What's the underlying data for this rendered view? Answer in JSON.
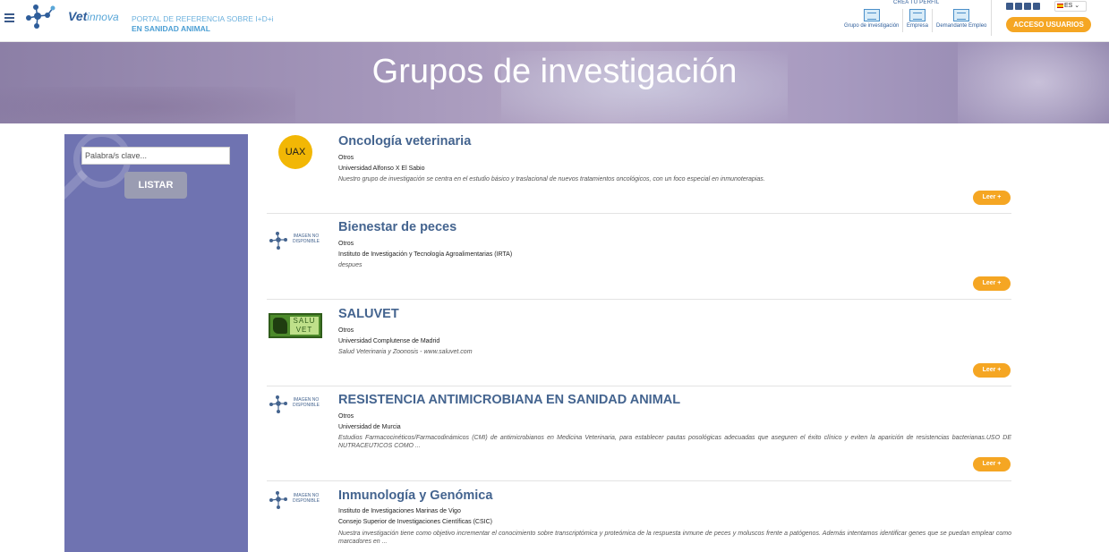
{
  "header": {
    "logo_main": "Vet",
    "logo_sub": "innova",
    "tagline_line1": "PORTAL DE REFERENCIA SOBRE I+D+i",
    "tagline_line2": "EN SANIDAD ANIMAL",
    "crea_label": "CREA TU PERFIL",
    "profile_options": [
      {
        "label": "Grupo de investigación"
      },
      {
        "label": "Empresa"
      },
      {
        "label": "Demandante Empleo"
      }
    ],
    "language": "ES",
    "access_button": "ACCESO USUARIOS"
  },
  "hero": {
    "title": "Grupos de investigación"
  },
  "sidebar": {
    "search_placeholder": "Palabra/s clave...",
    "list_button": "LISTAR"
  },
  "results": [
    {
      "title": "Oncología veterinaria",
      "line1": "Otros",
      "line2": "Universidad Alfonso X El Sabio",
      "description": "Nuestro grupo de investigación se centra en el estudio básico y traslacional de nuevos tratamientos oncológicos, con un foco especial en inmunoterapias.",
      "thumb": "UAX",
      "read_more": "Leer +"
    },
    {
      "title": "Bienestar de peces",
      "line1": "Otros",
      "line2": "Instituto de Investigación y Tecnología Agroalimentarias (IRTA)",
      "description": "despues",
      "thumb": "IMAGEN NO DISPONIBLE",
      "read_more": "Leer +"
    },
    {
      "title": "SALUVET",
      "line1": "Otros",
      "line2": "Universidad Complutense de Madrid",
      "description": "Salud Veterinaria y Zoonosis - www.saluvet.com",
      "thumb": "SALU VET",
      "read_more": "Leer +"
    },
    {
      "title": "RESISTENCIA ANTIMICROBIANA EN SANIDAD ANIMAL",
      "line1": "Otros",
      "line2": "Universidad de Murcia",
      "description": "Estudios Farmacocinéticos/Farmacodinámicos (CMI) de antimicrobianos en Medicina Veterinaria, para establecer pautas posológicas adecuadas que aseguren el éxito clínico y eviten la aparición de resistencias bacterianas.USO DE NUTRACEUTICOS COMO ...",
      "thumb": "IMAGEN NO DISPONIBLE",
      "read_more": "Leer +"
    },
    {
      "title": "Inmunología y Genómica",
      "line1": "Instituto de Investigaciones Marinas de Vigo",
      "line2": "Consejo Superior de Investigaciones Científicas (CSIC)",
      "description": "Nuestra investigación tiene como objetivo incrementar el conocimiento sobre transcriptómica y proteómica de la respuesta inmune de peces y moluscos frente a patógenos. Además intentamos identificar genes que se puedan emplear como marcadores en ...",
      "thumb": "IMAGEN NO DISPONIBLE"
    }
  ]
}
